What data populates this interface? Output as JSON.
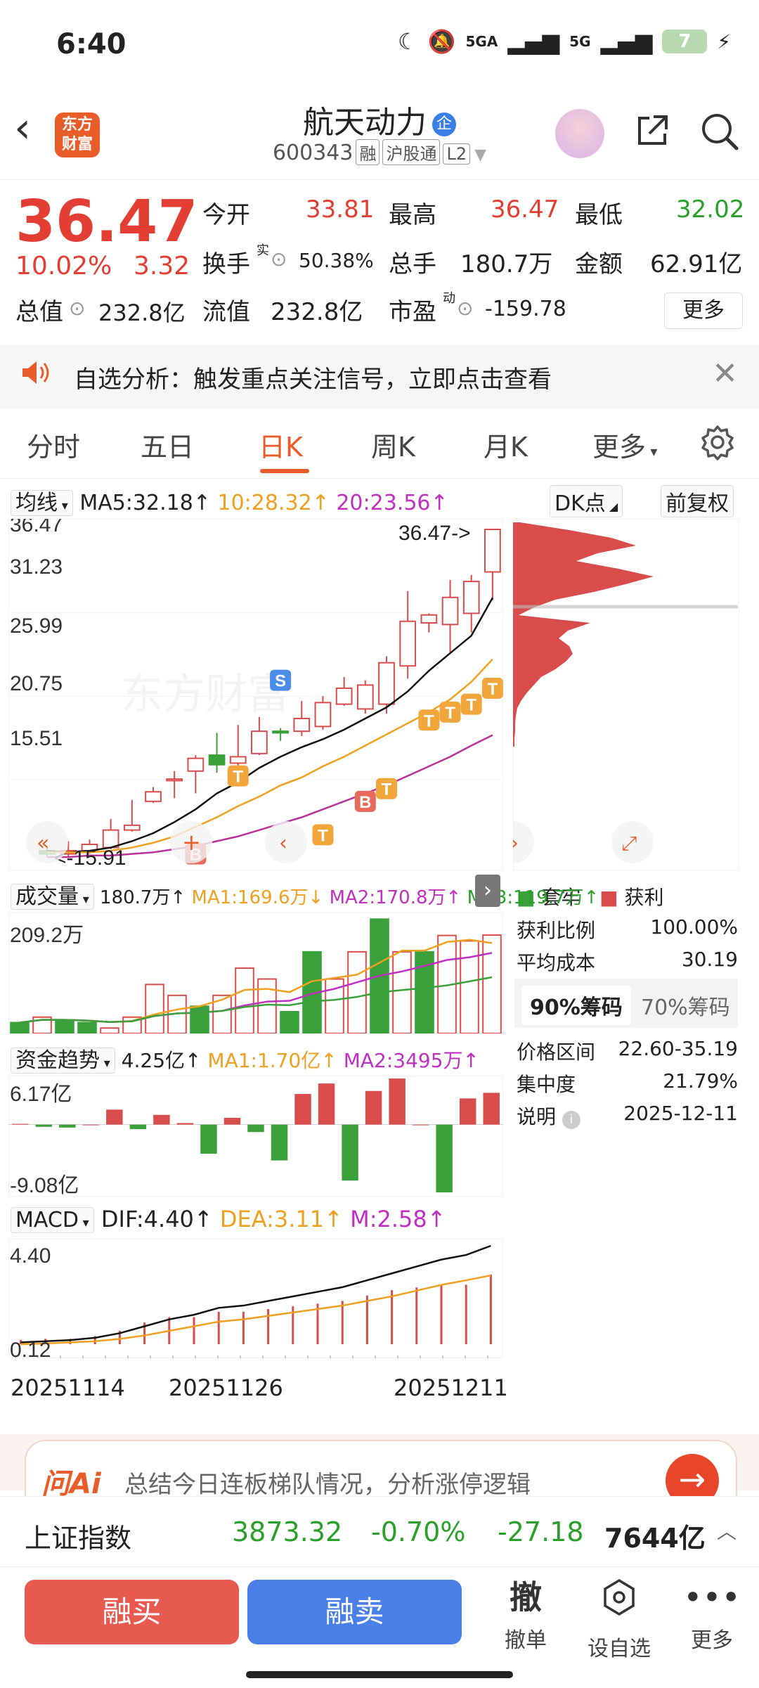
{
  "status": {
    "time": "6:40",
    "net1": "5GA",
    "net2": "5G",
    "battery": "7"
  },
  "header": {
    "logo_line1": "东方",
    "logo_line2": "财富",
    "name": "航天动力",
    "badge": "企",
    "code": "600343",
    "tags": [
      "融",
      "沪股通",
      "L2"
    ]
  },
  "quote": {
    "price": "36.47",
    "pct": "10.02%",
    "change": "3.32",
    "open_label": "今开",
    "open": "33.81",
    "high_label": "最高",
    "high": "36.47",
    "low_label": "最低",
    "low": "32.02",
    "turnover_label": "换手",
    "turnover_sup": "实",
    "turnover": "50.38%",
    "volume_label": "总手",
    "volume": "180.7万",
    "amount_label": "金额",
    "amount": "62.91亿",
    "mcap_label": "总值",
    "mcap": "232.8亿",
    "float_label": "流值",
    "float_mcap": "232.8亿",
    "pe_label": "市盈",
    "pe_sup": "动",
    "pe": "-159.78",
    "more": "更多"
  },
  "banner": {
    "text": "自选分析：触发重点关注信号，立即点击查看"
  },
  "tabs": [
    "分时",
    "五日",
    "日K",
    "周K",
    "月K",
    "更多"
  ],
  "kline": {
    "indicator_select": "均线",
    "ma5": "MA5:32.18",
    "ma10": "10:28.32",
    "ma20": "20:23.56",
    "dk": "DK点",
    "adjust": "前复权",
    "y_labels": [
      "36.47",
      "31.23",
      "25.99",
      "20.75",
      "15.51"
    ],
    "max_mark": "36.47->",
    "min_mark": "<-15.91",
    "watermark": "东方财富",
    "marker_S": "S",
    "marker_T": "T",
    "marker_B": "B"
  },
  "volume": {
    "select": "成交量",
    "value": "180.7万",
    "ma1": "MA1:169.6万",
    "ma2": "MA2:170.8万",
    "ma3": "MA3:119.7万",
    "y_top": "209.2万"
  },
  "fund": {
    "select": "资金趋势",
    "value": "4.25亿",
    "ma1": "MA1:1.70亿",
    "ma2": "MA2:3495万",
    "y_top": "6.17亿",
    "y_bottom": "-9.08亿"
  },
  "macd": {
    "select": "MACD",
    "dif": "DIF:4.40",
    "dea": "DEA:3.11",
    "m": "M:2.58",
    "y_top": "4.40",
    "y_bottom": "0.12",
    "dates": [
      "20251114",
      "20251126",
      "20251211"
    ]
  },
  "chip": {
    "legend_trap": "套牢",
    "legend_profit": "获利",
    "profit_ratio_label": "获利比例",
    "profit_ratio": "100.00%",
    "avg_cost_label": "平均成本",
    "avg_cost": "30.19",
    "tab90": "90%筹码",
    "tab70": "70%筹码",
    "range_label": "价格区间",
    "range": "22.60-35.19",
    "conc_label": "集中度",
    "conc": "21.79%",
    "note_label": "说明",
    "note": "2025-12-11"
  },
  "ai": {
    "logo": "问Ai",
    "text": "总结今日连板梯队情况，分析涨停逻辑"
  },
  "index": {
    "name": "上证指数",
    "value": "3873.32",
    "pct": "-0.70%",
    "chg": "-27.18",
    "amount": "7644亿"
  },
  "actions": {
    "buy": "融买",
    "sell": "融卖",
    "cancel_icon": "撤",
    "cancel": "撤单",
    "watch": "设自选",
    "more": "更多"
  },
  "chart_data": {
    "type": "candlestick",
    "x": [
      "20251114",
      "20251126",
      "20251211"
    ],
    "ylim": [
      15.51,
      36.47
    ],
    "candles": [
      {
        "o": 16.3,
        "c": 16.1,
        "h": 16.6,
        "l": 15.91
      },
      {
        "o": 16.1,
        "c": 16.3,
        "h": 16.9,
        "l": 15.95
      },
      {
        "o": 16.3,
        "c": 16.7,
        "h": 17.0,
        "l": 16.1
      },
      {
        "o": 16.5,
        "c": 17.6,
        "h": 18.3,
        "l": 16.4
      },
      {
        "o": 17.6,
        "c": 17.9,
        "h": 19.5,
        "l": 17.5
      },
      {
        "o": 19.4,
        "c": 20.0,
        "h": 20.3,
        "l": 19.3
      },
      {
        "o": 20.7,
        "c": 20.8,
        "h": 21.3,
        "l": 19.6
      },
      {
        "o": 21.3,
        "c": 22.1,
        "h": 22.3,
        "l": 19.9
      },
      {
        "o": 22.3,
        "c": 21.7,
        "h": 23.7,
        "l": 21.2
      },
      {
        "o": 21.8,
        "c": 22.2,
        "h": 24.2,
        "l": 21.0
      },
      {
        "o": 22.4,
        "c": 23.8,
        "h": 24.7,
        "l": 22.3
      },
      {
        "o": 23.8,
        "c": 23.7,
        "h": 24.0,
        "l": 23.2
      },
      {
        "o": 23.8,
        "c": 24.6,
        "h": 25.7,
        "l": 23.5
      },
      {
        "o": 24.1,
        "c": 25.6,
        "h": 26.0,
        "l": 23.9
      },
      {
        "o": 25.5,
        "c": 26.5,
        "h": 27.2,
        "l": 25.4
      },
      {
        "o": 25.2,
        "c": 26.7,
        "h": 27.0,
        "l": 24.9
      },
      {
        "o": 25.5,
        "c": 28.1,
        "h": 28.5,
        "l": 24.9
      },
      {
        "o": 27.9,
        "c": 30.7,
        "h": 32.6,
        "l": 27.1
      },
      {
        "o": 30.6,
        "c": 31.1,
        "h": 31.2,
        "l": 30.0
      },
      {
        "o": 30.5,
        "c": 32.2,
        "h": 33.3,
        "l": 28.7
      },
      {
        "o": 31.2,
        "c": 33.2,
        "h": 33.6,
        "l": 30.0
      },
      {
        "o": 33.8,
        "c": 36.47,
        "h": 36.47,
        "l": 32.02
      }
    ],
    "ma5": [
      16.3,
      16.2,
      16.3,
      16.5,
      16.9,
      17.4,
      18.1,
      18.9,
      19.9,
      20.6,
      21.5,
      22.2,
      22.8,
      23.3,
      23.9,
      24.6,
      25.3,
      26.3,
      27.6,
      28.7,
      29.8,
      32.18
    ],
    "ma10": [
      16.2,
      16.2,
      16.2,
      16.3,
      16.5,
      16.8,
      17.2,
      17.8,
      18.4,
      19.1,
      19.7,
      20.4,
      20.9,
      21.6,
      22.2,
      22.9,
      23.6,
      24.3,
      25.0,
      25.8,
      26.9,
      28.32
    ],
    "ma20": [
      15.9,
      15.9,
      16.0,
      16.0,
      16.1,
      16.2,
      16.4,
      16.6,
      16.9,
      17.2,
      17.6,
      18.0,
      18.4,
      18.9,
      19.4,
      19.9,
      20.4,
      21.0,
      21.6,
      22.2,
      22.9,
      23.56
    ],
    "volume": [
      20,
      30,
      25,
      20,
      10,
      30,
      90,
      70,
      50,
      70,
      120,
      100,
      40,
      150,
      100,
      150,
      210,
      150,
      150,
      180,
      170,
      180.7
    ],
    "volume_up": [
      false,
      true,
      false,
      false,
      true,
      true,
      true,
      true,
      false,
      true,
      true,
      true,
      false,
      false,
      true,
      true,
      false,
      true,
      false,
      true,
      true,
      true
    ],
    "fund": [
      0.1,
      -0.3,
      -0.4,
      0.0,
      2.0,
      -0.6,
      1.3,
      0.2,
      -3.9,
      0.9,
      -1.0,
      -4.8,
      4.1,
      5.5,
      -7.5,
      4.5,
      6.17,
      0.0,
      -9.08,
      3.5,
      4.25
    ],
    "macd_dif": [
      0.2,
      0.25,
      0.3,
      0.4,
      0.6,
      0.9,
      1.2,
      1.4,
      1.7,
      1.8,
      2.0,
      2.2,
      2.4,
      2.6,
      2.9,
      3.2,
      3.5,
      3.8,
      4.0,
      4.4
    ],
    "macd_dea": [
      0.12,
      0.15,
      0.2,
      0.25,
      0.35,
      0.5,
      0.7,
      0.9,
      1.1,
      1.2,
      1.35,
      1.5,
      1.65,
      1.8,
      2.0,
      2.2,
      2.45,
      2.7,
      2.9,
      3.11
    ]
  }
}
